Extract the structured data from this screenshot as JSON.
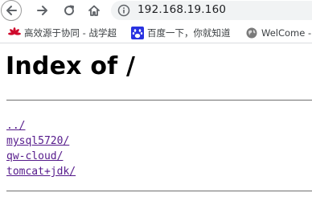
{
  "browser": {
    "url": "192.168.19.160",
    "bookmarks": [
      {
        "label": "高效源于协同 - 战学超",
        "icon": "huawei-flower-icon"
      },
      {
        "label": "百度一下，你就知道",
        "icon": "baidu-paw-icon"
      },
      {
        "label": "WelCome -",
        "icon": "globe-icon"
      }
    ]
  },
  "page": {
    "heading": "Index of /",
    "entries": [
      {
        "name": "../"
      },
      {
        "name": "mysql5720/"
      },
      {
        "name": "qw-cloud/"
      },
      {
        "name": "tomcat+jdk/"
      }
    ]
  },
  "colors": {
    "visited_link": "#551a8b",
    "omnibox_bg": "#f1f3f4",
    "huawei_red": "#cf0a2c",
    "baidu_blue": "#2932e1"
  }
}
